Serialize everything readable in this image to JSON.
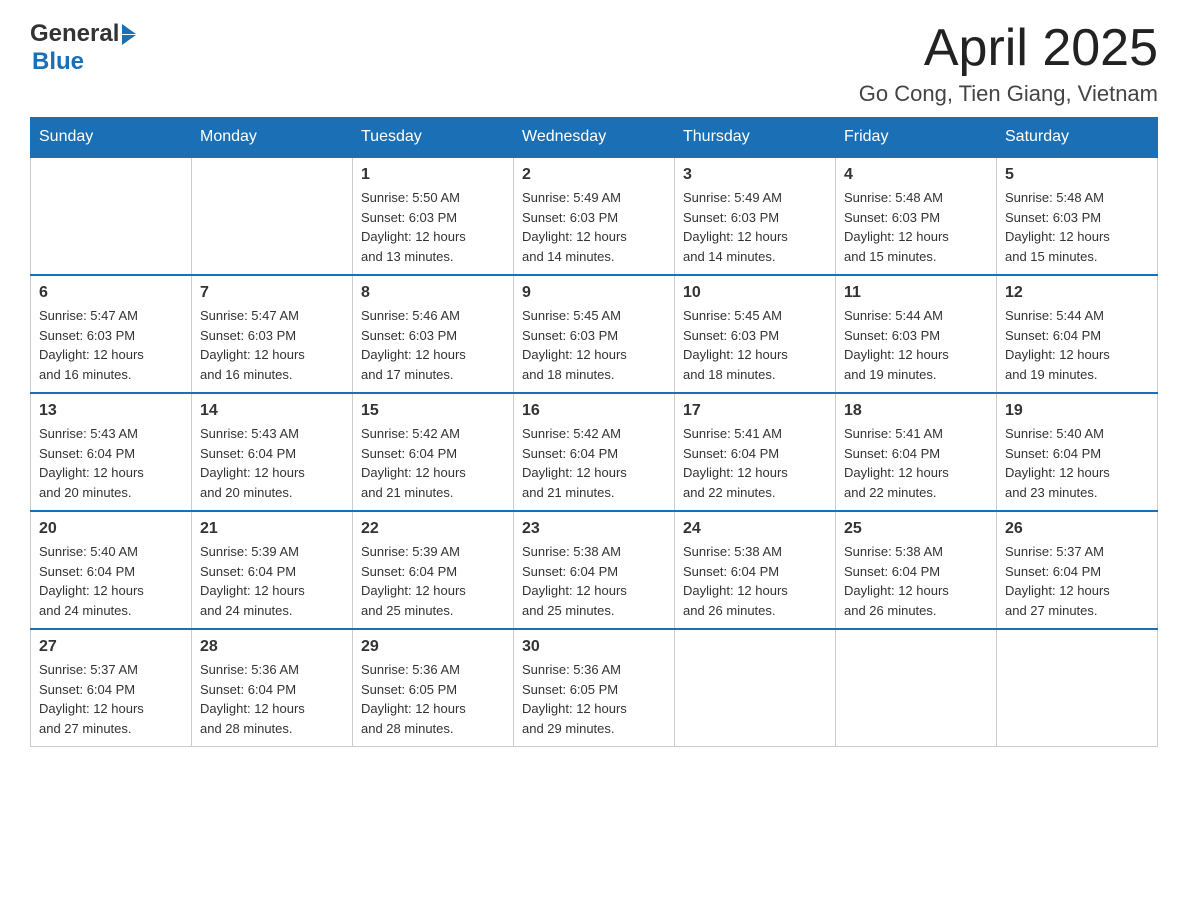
{
  "header": {
    "logo_general": "General",
    "logo_blue": "Blue",
    "month_title": "April 2025",
    "location": "Go Cong, Tien Giang, Vietnam"
  },
  "days_of_week": [
    "Sunday",
    "Monday",
    "Tuesday",
    "Wednesday",
    "Thursday",
    "Friday",
    "Saturday"
  ],
  "weeks": [
    [
      {
        "day": "",
        "info": ""
      },
      {
        "day": "",
        "info": ""
      },
      {
        "day": "1",
        "info": "Sunrise: 5:50 AM\nSunset: 6:03 PM\nDaylight: 12 hours\nand 13 minutes."
      },
      {
        "day": "2",
        "info": "Sunrise: 5:49 AM\nSunset: 6:03 PM\nDaylight: 12 hours\nand 14 minutes."
      },
      {
        "day": "3",
        "info": "Sunrise: 5:49 AM\nSunset: 6:03 PM\nDaylight: 12 hours\nand 14 minutes."
      },
      {
        "day": "4",
        "info": "Sunrise: 5:48 AM\nSunset: 6:03 PM\nDaylight: 12 hours\nand 15 minutes."
      },
      {
        "day": "5",
        "info": "Sunrise: 5:48 AM\nSunset: 6:03 PM\nDaylight: 12 hours\nand 15 minutes."
      }
    ],
    [
      {
        "day": "6",
        "info": "Sunrise: 5:47 AM\nSunset: 6:03 PM\nDaylight: 12 hours\nand 16 minutes."
      },
      {
        "day": "7",
        "info": "Sunrise: 5:47 AM\nSunset: 6:03 PM\nDaylight: 12 hours\nand 16 minutes."
      },
      {
        "day": "8",
        "info": "Sunrise: 5:46 AM\nSunset: 6:03 PM\nDaylight: 12 hours\nand 17 minutes."
      },
      {
        "day": "9",
        "info": "Sunrise: 5:45 AM\nSunset: 6:03 PM\nDaylight: 12 hours\nand 18 minutes."
      },
      {
        "day": "10",
        "info": "Sunrise: 5:45 AM\nSunset: 6:03 PM\nDaylight: 12 hours\nand 18 minutes."
      },
      {
        "day": "11",
        "info": "Sunrise: 5:44 AM\nSunset: 6:03 PM\nDaylight: 12 hours\nand 19 minutes."
      },
      {
        "day": "12",
        "info": "Sunrise: 5:44 AM\nSunset: 6:04 PM\nDaylight: 12 hours\nand 19 minutes."
      }
    ],
    [
      {
        "day": "13",
        "info": "Sunrise: 5:43 AM\nSunset: 6:04 PM\nDaylight: 12 hours\nand 20 minutes."
      },
      {
        "day": "14",
        "info": "Sunrise: 5:43 AM\nSunset: 6:04 PM\nDaylight: 12 hours\nand 20 minutes."
      },
      {
        "day": "15",
        "info": "Sunrise: 5:42 AM\nSunset: 6:04 PM\nDaylight: 12 hours\nand 21 minutes."
      },
      {
        "day": "16",
        "info": "Sunrise: 5:42 AM\nSunset: 6:04 PM\nDaylight: 12 hours\nand 21 minutes."
      },
      {
        "day": "17",
        "info": "Sunrise: 5:41 AM\nSunset: 6:04 PM\nDaylight: 12 hours\nand 22 minutes."
      },
      {
        "day": "18",
        "info": "Sunrise: 5:41 AM\nSunset: 6:04 PM\nDaylight: 12 hours\nand 22 minutes."
      },
      {
        "day": "19",
        "info": "Sunrise: 5:40 AM\nSunset: 6:04 PM\nDaylight: 12 hours\nand 23 minutes."
      }
    ],
    [
      {
        "day": "20",
        "info": "Sunrise: 5:40 AM\nSunset: 6:04 PM\nDaylight: 12 hours\nand 24 minutes."
      },
      {
        "day": "21",
        "info": "Sunrise: 5:39 AM\nSunset: 6:04 PM\nDaylight: 12 hours\nand 24 minutes."
      },
      {
        "day": "22",
        "info": "Sunrise: 5:39 AM\nSunset: 6:04 PM\nDaylight: 12 hours\nand 25 minutes."
      },
      {
        "day": "23",
        "info": "Sunrise: 5:38 AM\nSunset: 6:04 PM\nDaylight: 12 hours\nand 25 minutes."
      },
      {
        "day": "24",
        "info": "Sunrise: 5:38 AM\nSunset: 6:04 PM\nDaylight: 12 hours\nand 26 minutes."
      },
      {
        "day": "25",
        "info": "Sunrise: 5:38 AM\nSunset: 6:04 PM\nDaylight: 12 hours\nand 26 minutes."
      },
      {
        "day": "26",
        "info": "Sunrise: 5:37 AM\nSunset: 6:04 PM\nDaylight: 12 hours\nand 27 minutes."
      }
    ],
    [
      {
        "day": "27",
        "info": "Sunrise: 5:37 AM\nSunset: 6:04 PM\nDaylight: 12 hours\nand 27 minutes."
      },
      {
        "day": "28",
        "info": "Sunrise: 5:36 AM\nSunset: 6:04 PM\nDaylight: 12 hours\nand 28 minutes."
      },
      {
        "day": "29",
        "info": "Sunrise: 5:36 AM\nSunset: 6:05 PM\nDaylight: 12 hours\nand 28 minutes."
      },
      {
        "day": "30",
        "info": "Sunrise: 5:36 AM\nSunset: 6:05 PM\nDaylight: 12 hours\nand 29 minutes."
      },
      {
        "day": "",
        "info": ""
      },
      {
        "day": "",
        "info": ""
      },
      {
        "day": "",
        "info": ""
      }
    ]
  ]
}
